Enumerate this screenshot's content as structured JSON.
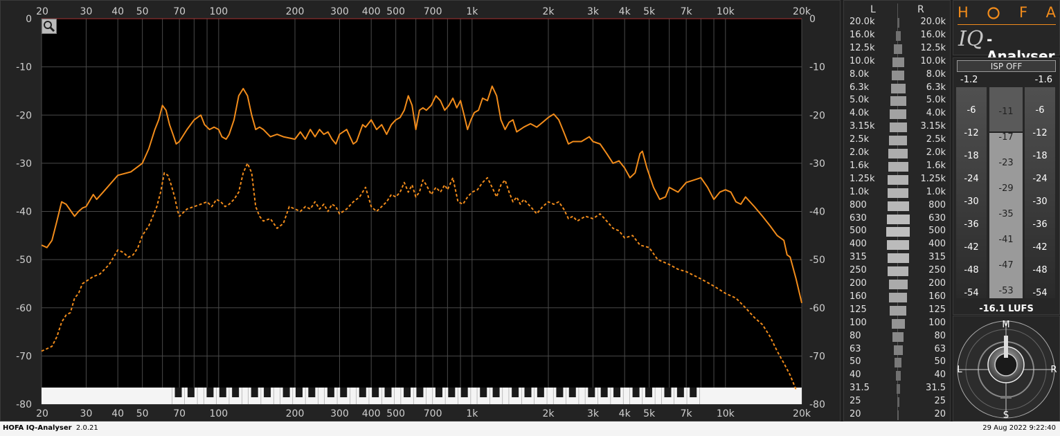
{
  "app": {
    "name": "HOFA IQ-Analyser",
    "version": "2.0.21",
    "datetime": "29 Aug 2022 9:22:40"
  },
  "spectrum": {
    "freq_ticks": [
      {
        "f": 20,
        "label": "20"
      },
      {
        "f": 30,
        "label": "30"
      },
      {
        "f": 40,
        "label": "40"
      },
      {
        "f": 50,
        "label": "50"
      },
      {
        "f": 70,
        "label": "70"
      },
      {
        "f": 100,
        "label": "100"
      },
      {
        "f": 200,
        "label": "200"
      },
      {
        "f": 300,
        "label": "300"
      },
      {
        "f": 400,
        "label": "400"
      },
      {
        "f": 500,
        "label": "500"
      },
      {
        "f": 700,
        "label": "700"
      },
      {
        "f": 1000,
        "label": "1k"
      },
      {
        "f": 2000,
        "label": "2k"
      },
      {
        "f": 3000,
        "label": "3k"
      },
      {
        "f": 4000,
        "label": "4k"
      },
      {
        "f": 5000,
        "label": "5k"
      },
      {
        "f": 7000,
        "label": "7k"
      },
      {
        "f": 10000,
        "label": "10k"
      },
      {
        "f": 20000,
        "label": "20k"
      }
    ],
    "db_ticks": [
      {
        "v": 0,
        "label": "0"
      },
      {
        "v": -10,
        "label": "-10"
      },
      {
        "v": -20,
        "label": "-20"
      },
      {
        "v": -30,
        "label": "-30"
      },
      {
        "v": -40,
        "label": "-40"
      },
      {
        "v": -50,
        "label": "-50"
      },
      {
        "v": -60,
        "label": "-60"
      },
      {
        "v": -70,
        "label": "-70"
      },
      {
        "v": -80,
        "label": "-80"
      }
    ],
    "colors": {
      "curve": "#f28c1b",
      "grid": "#4a4a4a",
      "background": "#000000"
    },
    "peak_curve": [
      [
        20,
        -47
      ],
      [
        21,
        -47.5
      ],
      [
        22,
        -46
      ],
      [
        23,
        -42
      ],
      [
        24,
        -38
      ],
      [
        25,
        -38.5
      ],
      [
        27,
        -41
      ],
      [
        28,
        -40
      ],
      [
        29,
        -39.3
      ],
      [
        30,
        -39
      ],
      [
        32,
        -36.5
      ],
      [
        33,
        -37.5
      ],
      [
        35,
        -36
      ],
      [
        40,
        -32.5
      ],
      [
        45,
        -31.8
      ],
      [
        50,
        -30
      ],
      [
        53,
        -27
      ],
      [
        56,
        -23
      ],
      [
        58,
        -21
      ],
      [
        60,
        -18
      ],
      [
        62,
        -19
      ],
      [
        64,
        -22
      ],
      [
        66,
        -24
      ],
      [
        68,
        -26
      ],
      [
        70,
        -25.5
      ],
      [
        75,
        -23
      ],
      [
        80,
        -21
      ],
      [
        85,
        -20
      ],
      [
        88,
        -22
      ],
      [
        92,
        -23
      ],
      [
        96,
        -22.5
      ],
      [
        100,
        -23
      ],
      [
        103,
        -24.5
      ],
      [
        107,
        -25
      ],
      [
        110,
        -24
      ],
      [
        115,
        -21
      ],
      [
        120,
        -16
      ],
      [
        125,
        -14.5
      ],
      [
        130,
        -16
      ],
      [
        135,
        -20
      ],
      [
        140,
        -23
      ],
      [
        145,
        -22.5
      ],
      [
        150,
        -23
      ],
      [
        160,
        -24.5
      ],
      [
        170,
        -24
      ],
      [
        180,
        -24.5
      ],
      [
        200,
        -25
      ],
      [
        210,
        -23.5
      ],
      [
        220,
        -25
      ],
      [
        230,
        -23
      ],
      [
        240,
        -24.5
      ],
      [
        250,
        -23
      ],
      [
        260,
        -24
      ],
      [
        270,
        -23.5
      ],
      [
        280,
        -25
      ],
      [
        290,
        -26
      ],
      [
        300,
        -24
      ],
      [
        320,
        -23
      ],
      [
        340,
        -26
      ],
      [
        350,
        -25.5
      ],
      [
        370,
        -22
      ],
      [
        380,
        -22.5
      ],
      [
        400,
        -21
      ],
      [
        420,
        -23
      ],
      [
        440,
        -22
      ],
      [
        460,
        -24
      ],
      [
        480,
        -22
      ],
      [
        500,
        -21
      ],
      [
        520,
        -20.5
      ],
      [
        540,
        -19
      ],
      [
        560,
        -16
      ],
      [
        580,
        -18
      ],
      [
        600,
        -23
      ],
      [
        620,
        -19
      ],
      [
        640,
        -18.5
      ],
      [
        660,
        -19
      ],
      [
        690,
        -18
      ],
      [
        720,
        -16
      ],
      [
        750,
        -17
      ],
      [
        780,
        -19
      ],
      [
        810,
        -18
      ],
      [
        840,
        -16.5
      ],
      [
        870,
        -18.5
      ],
      [
        900,
        -17
      ],
      [
        930,
        -20
      ],
      [
        960,
        -23
      ],
      [
        990,
        -21
      ],
      [
        1020,
        -19.5
      ],
      [
        1060,
        -19
      ],
      [
        1100,
        -16.5
      ],
      [
        1150,
        -17
      ],
      [
        1200,
        -14
      ],
      [
        1250,
        -16
      ],
      [
        1300,
        -21
      ],
      [
        1350,
        -23
      ],
      [
        1400,
        -21.5
      ],
      [
        1450,
        -21
      ],
      [
        1500,
        -23.5
      ],
      [
        1600,
        -22.5
      ],
      [
        1700,
        -21.8
      ],
      [
        1800,
        -22.5
      ],
      [
        1900,
        -21.5
      ],
      [
        2000,
        -20.5
      ],
      [
        2100,
        -19.8
      ],
      [
        2200,
        -21
      ],
      [
        2300,
        -23.5
      ],
      [
        2400,
        -26
      ],
      [
        2500,
        -25.5
      ],
      [
        2700,
        -25.5
      ],
      [
        2900,
        -24.5
      ],
      [
        3000,
        -25.5
      ],
      [
        3200,
        -26
      ],
      [
        3400,
        -28
      ],
      [
        3600,
        -30
      ],
      [
        3800,
        -29.5
      ],
      [
        4000,
        -31
      ],
      [
        4200,
        -33
      ],
      [
        4400,
        -32
      ],
      [
        4600,
        -28
      ],
      [
        4700,
        -27.5
      ],
      [
        4900,
        -31
      ],
      [
        5200,
        -35
      ],
      [
        5500,
        -37.5
      ],
      [
        5800,
        -37
      ],
      [
        6000,
        -35
      ],
      [
        6500,
        -36
      ],
      [
        7000,
        -34
      ],
      [
        7500,
        -33.5
      ],
      [
        8000,
        -33
      ],
      [
        8500,
        -35
      ],
      [
        9000,
        -37.5
      ],
      [
        9500,
        -36
      ],
      [
        10000,
        -35.5
      ],
      [
        10500,
        -36
      ],
      [
        11000,
        -38
      ],
      [
        11500,
        -38.5
      ],
      [
        12000,
        -37
      ],
      [
        13000,
        -39
      ],
      [
        14000,
        -41
      ],
      [
        15000,
        -43
      ],
      [
        16000,
        -45
      ],
      [
        17000,
        -46
      ],
      [
        17500,
        -49
      ],
      [
        18000,
        -49.5
      ],
      [
        19000,
        -54
      ],
      [
        20000,
        -59
      ]
    ],
    "average_curve": [
      [
        20,
        -69
      ],
      [
        21,
        -68.5
      ],
      [
        22,
        -68
      ],
      [
        23,
        -66
      ],
      [
        24,
        -63
      ],
      [
        25,
        -61.5
      ],
      [
        26,
        -61
      ],
      [
        27,
        -58
      ],
      [
        28,
        -57
      ],
      [
        29,
        -55
      ],
      [
        30,
        -54.5
      ],
      [
        32,
        -53.5
      ],
      [
        34,
        -53
      ],
      [
        37,
        -51
      ],
      [
        40,
        -48
      ],
      [
        42,
        -48.5
      ],
      [
        44,
        -49.5
      ],
      [
        46,
        -49
      ],
      [
        48,
        -47.5
      ],
      [
        50,
        -45
      ],
      [
        53,
        -43
      ],
      [
        55,
        -41
      ],
      [
        57,
        -39
      ],
      [
        59,
        -36
      ],
      [
        61,
        -32
      ],
      [
        63,
        -32.5
      ],
      [
        65,
        -34.5
      ],
      [
        67,
        -37
      ],
      [
        69,
        -40
      ],
      [
        70,
        -41
      ],
      [
        75,
        -39.5
      ],
      [
        80,
        -39
      ],
      [
        85,
        -38.5
      ],
      [
        90,
        -38
      ],
      [
        94,
        -39
      ],
      [
        98,
        -37.5
      ],
      [
        102,
        -38
      ],
      [
        106,
        -39
      ],
      [
        110,
        -38.5
      ],
      [
        115,
        -37.5
      ],
      [
        120,
        -36
      ],
      [
        125,
        -32
      ],
      [
        130,
        -30
      ],
      [
        135,
        -32
      ],
      [
        140,
        -39
      ],
      [
        145,
        -41
      ],
      [
        150,
        -42
      ],
      [
        160,
        -41.5
      ],
      [
        170,
        -43.5
      ],
      [
        180,
        -42.5
      ],
      [
        190,
        -39
      ],
      [
        200,
        -39.5
      ],
      [
        210,
        -40
      ],
      [
        220,
        -39
      ],
      [
        230,
        -39.5
      ],
      [
        240,
        -38
      ],
      [
        250,
        -39.5
      ],
      [
        260,
        -38.5
      ],
      [
        270,
        -40
      ],
      [
        280,
        -38.5
      ],
      [
        290,
        -39
      ],
      [
        300,
        -40.5
      ],
      [
        320,
        -39.5
      ],
      [
        340,
        -38
      ],
      [
        360,
        -37
      ],
      [
        380,
        -35
      ],
      [
        400,
        -39
      ],
      [
        420,
        -40
      ],
      [
        440,
        -39
      ],
      [
        460,
        -38
      ],
      [
        480,
        -36.5
      ],
      [
        500,
        -37
      ],
      [
        520,
        -36
      ],
      [
        540,
        -34
      ],
      [
        560,
        -36
      ],
      [
        580,
        -34.5
      ],
      [
        600,
        -37
      ],
      [
        620,
        -36
      ],
      [
        640,
        -33.5
      ],
      [
        660,
        -34.5
      ],
      [
        690,
        -36.5
      ],
      [
        720,
        -35
      ],
      [
        750,
        -36
      ],
      [
        780,
        -34.5
      ],
      [
        800,
        -35.5
      ],
      [
        840,
        -33
      ],
      [
        880,
        -38
      ],
      [
        920,
        -38.5
      ],
      [
        960,
        -37
      ],
      [
        1000,
        -36
      ],
      [
        1050,
        -35.5
      ],
      [
        1100,
        -34
      ],
      [
        1150,
        -33
      ],
      [
        1200,
        -35
      ],
      [
        1250,
        -37
      ],
      [
        1300,
        -34.5
      ],
      [
        1350,
        -33.5
      ],
      [
        1400,
        -36
      ],
      [
        1450,
        -38
      ],
      [
        1500,
        -37
      ],
      [
        1550,
        -38.5
      ],
      [
        1600,
        -37.5
      ],
      [
        1700,
        -39
      ],
      [
        1800,
        -40.5
      ],
      [
        1900,
        -39
      ],
      [
        2000,
        -38
      ],
      [
        2100,
        -38.5
      ],
      [
        2200,
        -38
      ],
      [
        2300,
        -39.5
      ],
      [
        2400,
        -41.5
      ],
      [
        2500,
        -41
      ],
      [
        2600,
        -42
      ],
      [
        2800,
        -41
      ],
      [
        3000,
        -41.5
      ],
      [
        3200,
        -40.5
      ],
      [
        3400,
        -42
      ],
      [
        3600,
        -43.5
      ],
      [
        3800,
        -44
      ],
      [
        4000,
        -45.5
      ],
      [
        4300,
        -45
      ],
      [
        4600,
        -47
      ],
      [
        5000,
        -47.5
      ],
      [
        5400,
        -50
      ],
      [
        6000,
        -51
      ],
      [
        6500,
        -52
      ],
      [
        7000,
        -52.5
      ],
      [
        8000,
        -54
      ],
      [
        9000,
        -55.5
      ],
      [
        10000,
        -57
      ],
      [
        11000,
        -58
      ],
      [
        12000,
        -60
      ],
      [
        13000,
        -62
      ],
      [
        14000,
        -63.5
      ],
      [
        15000,
        -66
      ],
      [
        16000,
        -69
      ],
      [
        17000,
        -71.5
      ],
      [
        18000,
        -74
      ],
      [
        19000,
        -77
      ]
    ]
  },
  "bands": {
    "header_left": "L",
    "header_right": "R",
    "labels": [
      "20.0k",
      "16.0k",
      "12.5k",
      "10.0k",
      "8.0k",
      "6.3k",
      "5.0k",
      "4.0k",
      "3.15k",
      "2.5k",
      "2.0k",
      "1.6k",
      "1.25k",
      "1.0k",
      "800",
      "630",
      "500",
      "400",
      "315",
      "250",
      "200",
      "160",
      "125",
      "100",
      "80",
      "63",
      "50",
      "40",
      "31.5",
      "25",
      "20"
    ],
    "levels": [
      0.05,
      0.12,
      0.2,
      0.28,
      0.3,
      0.35,
      0.38,
      0.4,
      0.42,
      0.44,
      0.46,
      0.48,
      0.5,
      0.5,
      0.52,
      0.55,
      0.56,
      0.54,
      0.52,
      0.5,
      0.45,
      0.43,
      0.4,
      0.32,
      0.26,
      0.22,
      0.17,
      0.12,
      0.08,
      0.05,
      0.03
    ]
  },
  "logo": {
    "letters": [
      "H",
      "O",
      "F",
      "A"
    ],
    "iq": "IQ",
    "name": "-Analyser"
  },
  "meter": {
    "isp_label": "ISP OFF",
    "peak_left": "-1.2",
    "peak_right": "-1.6",
    "side_scale": [
      "-6",
      "-12",
      "-18",
      "-24",
      "-30",
      "-36",
      "-42",
      "-48",
      "-54"
    ],
    "center_scale": [
      "-11",
      "-17",
      "-23",
      "-29",
      "-35",
      "-41",
      "-47",
      "-53"
    ],
    "lufs": "-16.1 LUFS",
    "loudness_fill": 0.21
  },
  "scope": {
    "top": "M",
    "left": "L",
    "right": "R",
    "bottom": "S"
  }
}
